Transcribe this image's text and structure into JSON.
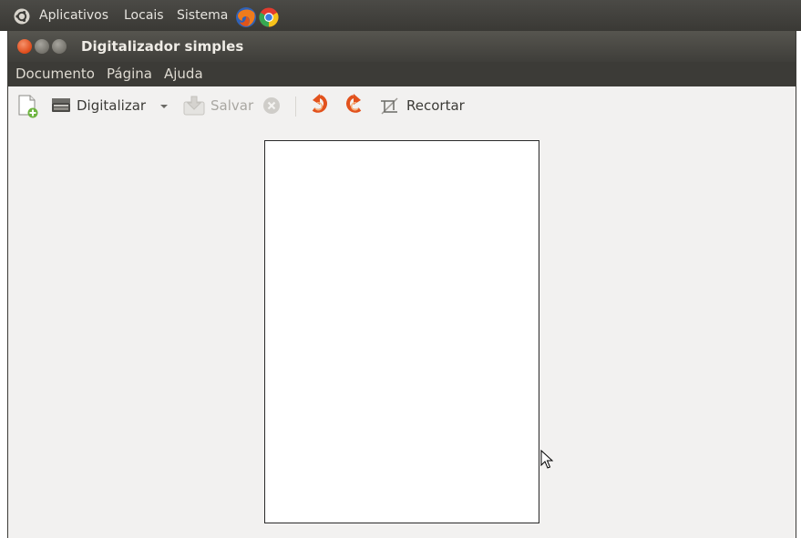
{
  "panel": {
    "menus": [
      {
        "label": "Aplicativos"
      },
      {
        "label": "Locais"
      },
      {
        "label": "Sistema"
      }
    ],
    "launchers": [
      "firefox-icon",
      "chrome-icon"
    ]
  },
  "window": {
    "title": "Digitalizador simples",
    "controls": [
      "close-icon",
      "minimize-icon",
      "maximize-icon"
    ]
  },
  "menubar": {
    "items": [
      {
        "label": "Documento"
      },
      {
        "label": "Página"
      },
      {
        "label": "Ajuda"
      }
    ]
  },
  "toolbar": {
    "new_icon": "new-document-icon",
    "scan_label": "Digitalizar",
    "scan_icon": "scanner-icon",
    "scan_dropdown_icon": "chevron-down-icon",
    "save_label": "Salvar",
    "save_enabled": false,
    "stop_icon": "stop-icon",
    "stop_enabled": false,
    "rotate_left_icon": "rotate-left-icon",
    "rotate_right_icon": "rotate-right-icon",
    "crop_label": "Recortar",
    "crop_icon": "crop-icon"
  },
  "colors": {
    "panel_bg": "#3c3b37",
    "close_button": "#de4a19",
    "window_bg": "#f2f1f0",
    "rotate_accent": "#e2521d"
  }
}
